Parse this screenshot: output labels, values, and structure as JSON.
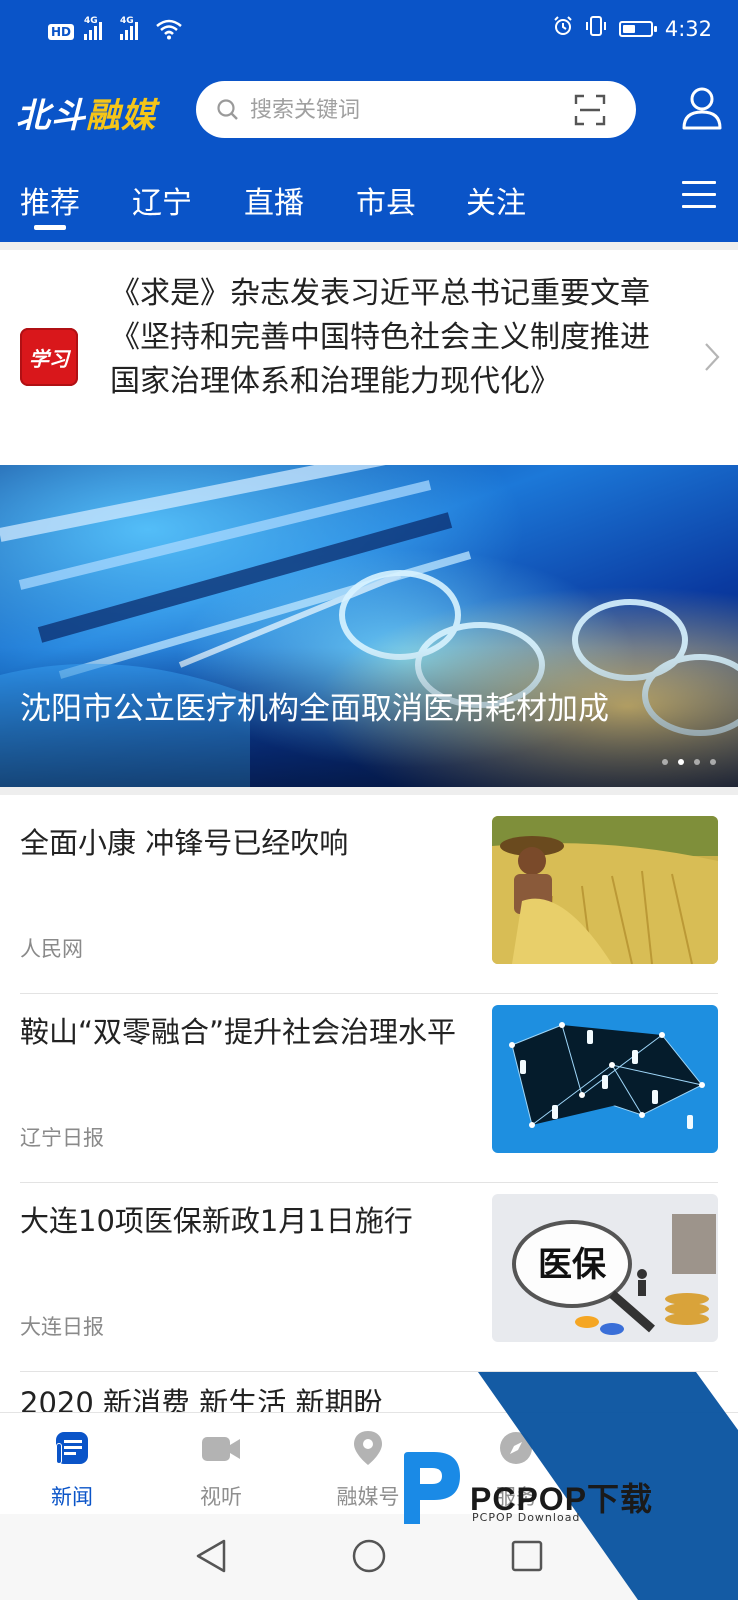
{
  "status_bar": {
    "hd_label": "HD",
    "network_1": "4G",
    "network_2": "4G",
    "time": "4:32",
    "battery_level": 0.45
  },
  "header": {
    "logo_main": "北斗",
    "logo_accent": "融媒",
    "search_placeholder": "搜索关键词",
    "brand_color": "#0a54c8",
    "accent_color": "#f5c518"
  },
  "tabs": [
    {
      "label": "推荐",
      "active": true
    },
    {
      "label": "辽宁",
      "active": false
    },
    {
      "label": "直播",
      "active": false
    },
    {
      "label": "市县",
      "active": false
    },
    {
      "label": "关注",
      "active": false
    }
  ],
  "pinned": {
    "badge_text": "学习",
    "title": "《求是》杂志发表习近平总书记重要文章《坚持和完善中国特色社会主义制度推进国家治理体系和治理能力现代化》"
  },
  "banner": {
    "title": "沈阳市公立医疗机构全面取消医用耗材加成",
    "slide_count": 4,
    "active_slide": 2
  },
  "news": [
    {
      "title": "全面小康 冲锋号已经吹响",
      "source": "人民网",
      "thumb": "farmer-harvest"
    },
    {
      "title": "鞍山“双零融合”提升社会治理水平",
      "source": "辽宁日报",
      "thumb": "network-people"
    },
    {
      "title": "大连10项医保新政1月1日施行",
      "source": "大连日报",
      "thumb": "medical-insurance",
      "thumb_text": "医保"
    }
  ],
  "partial_title": "2020 新消费 新生活 新期盼",
  "bottom_nav": [
    {
      "label": "新闻",
      "icon": "news-icon",
      "active": true
    },
    {
      "label": "视听",
      "icon": "video-camera-icon",
      "active": false
    },
    {
      "label": "融媒号",
      "icon": "location-pin-icon",
      "active": false
    },
    {
      "label": "服务",
      "icon": "compass-icon",
      "active": false
    }
  ],
  "watermark": {
    "text": "PCPOP下载",
    "subtext": "PCPOP Download"
  }
}
